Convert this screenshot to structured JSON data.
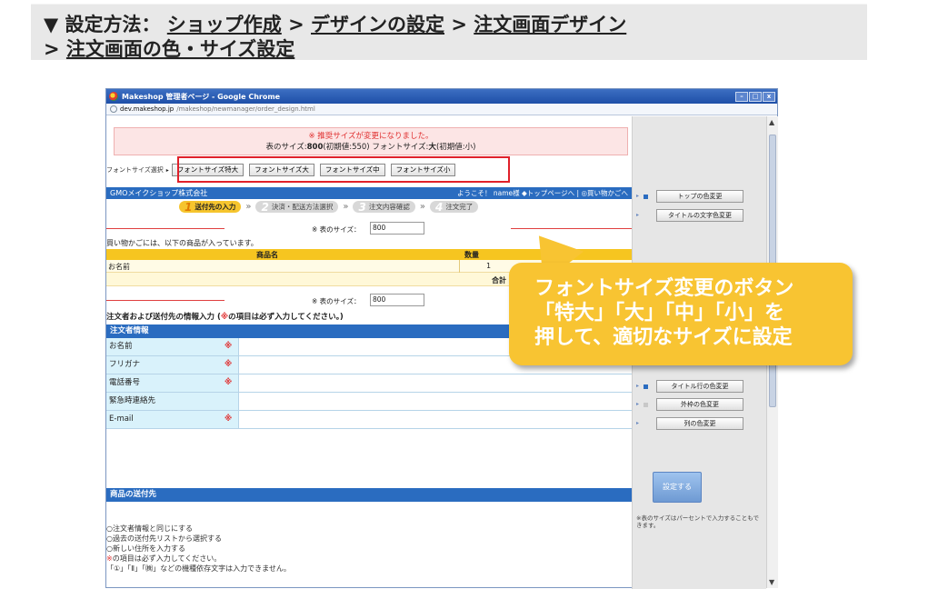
{
  "banner": {
    "prefix": "▼ 設定方法：",
    "crumb1": "ショップ作成",
    "crumb2": "デザインの設定",
    "crumb3": "注文画面デザイン",
    "crumb4": "注文画面の色・サイズ設定",
    "sep": ">"
  },
  "window": {
    "title": "Makeshop 管理者ページ - Google Chrome",
    "addr_host": "dev.makeshop.jp",
    "addr_path": "/makeshop/newmanager/order_design.html"
  },
  "notice": {
    "line1": "※ 推奨サイズが変更になりました。",
    "line2_a": "表のサイズ:",
    "line2_b": "800",
    "line2_c": "(初期値:550)  フォントサイズ:",
    "line2_d": "大",
    "line2_e": "(初期値:小)"
  },
  "font_size": {
    "label": "フォントサイズ選択",
    "buttons": [
      "フォントサイズ特大",
      "フォントサイズ大",
      "フォントサイズ中",
      "フォントサイズ小"
    ]
  },
  "shop": {
    "name": "GMOメイクショップ株式会社",
    "nav": "ようこそ！ name様 ◆トップページへ | ◎買い物かごへ"
  },
  "steps": [
    {
      "num": "1",
      "label": "送付先の入力"
    },
    {
      "num": "2",
      "label": "決済・配送方法選択"
    },
    {
      "num": "3",
      "label": "注文内容確認"
    },
    {
      "num": "4",
      "label": "注文完了"
    }
  ],
  "table_size": {
    "label": "※ 表のサイズ：",
    "value": "800"
  },
  "cart": {
    "message": "買い物かごには、以下の商品が入っています。",
    "col_name": "商品名",
    "col_qty": "数量",
    "row_name": "お名前",
    "row_qty": "1",
    "total_label": "合計"
  },
  "form": {
    "title_a": "注文者および送付先の情報入力 (",
    "title_b": "※",
    "title_c": "の項目は必ず入力してください。)",
    "section1": "注文者情報",
    "fields": [
      {
        "label": "お名前",
        "required": "※"
      },
      {
        "label": "フリガナ",
        "required": "※"
      },
      {
        "label": "電話番号",
        "required": "※"
      },
      {
        "label": "緊急時連絡先",
        "required": ""
      },
      {
        "label": "E-mail",
        "required": "※"
      }
    ],
    "section2": "商品の送付先",
    "ship_options": [
      "○注文者情報と同じにする",
      "○過去の送付先リストから選択する",
      "○新しい住所を入力する"
    ],
    "ship_note_req": "※",
    "ship_note_req_text": "の項目は必ず入力してください。",
    "ship_note2": "「①」「Ⅱ」「㈱」などの機種依存文字は入力できません。"
  },
  "right_pane": {
    "btn_top_color": "トップの色変更",
    "btn_title_text_color": "タイトルの文字色変更",
    "btn_title_row_color": "タイトル行の色変更",
    "btn_outer_color": "外枠の色変更",
    "btn_col_color": "列の色変更",
    "set_button": "設定する",
    "note": "※表のサイズはパーセントで入力することもできます。"
  },
  "callout": {
    "line1": "フォントサイズ変更のボタン",
    "line2": "「特大」「大」「中」「小」を",
    "line3": "押して、適切なサイズに設定"
  },
  "colors": {
    "accent_blue": "#2a6cc0",
    "highlight_red": "#e0202a",
    "callout_yellow": "#f8c432"
  }
}
